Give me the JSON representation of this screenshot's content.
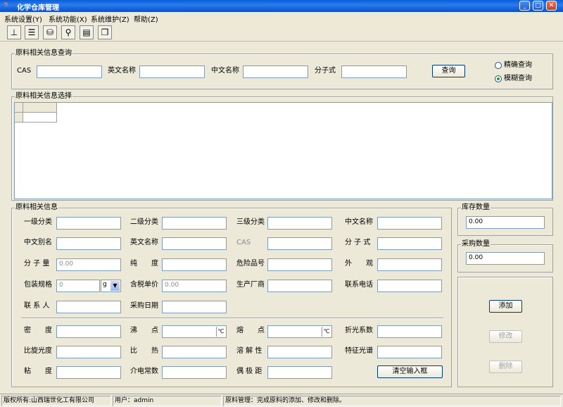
{
  "window": {
    "title": "化学仓库管理"
  },
  "menu": [
    "系统设置(Y)",
    "系统功能(X)",
    "系统维护(Z)",
    "帮助(Z)"
  ],
  "toolbar": {
    "icons": [
      "org-chart-icon",
      "document-list-icon",
      "database-icon",
      "binoculars-icon",
      "notepad-icon",
      "copy-icon"
    ],
    "glyphs": [
      "⊥",
      "☰",
      "⛁",
      "⚲",
      "▤",
      "❐"
    ]
  },
  "query": {
    "group_title": "原料相关信息查询",
    "cas_label": "CAS",
    "en_name_label": "英文名称",
    "cn_name_label": "中文名称",
    "formula_label": "分子式",
    "search_button": "查询",
    "exact_label": "精确查询",
    "fuzzy_label": "模糊查询"
  },
  "select": {
    "group_title": "原料相关信息选择"
  },
  "info": {
    "group_title": "原料相关信息",
    "level1": "一级分类",
    "level2": "二级分类",
    "level3": "三级分类",
    "cn_name": "中文名称",
    "cn_alias": "中文别名",
    "en_name": "英文名称",
    "cas": "CAS",
    "formula": "分 子 式",
    "mol_weight": "分 子 量",
    "mol_weight_value": "0.00",
    "purity": "纯　　度",
    "hazard_no": "危险品号",
    "appearance": "外　　观",
    "package": "包装规格",
    "package_value": "0",
    "package_unit": "g",
    "unit_price": "含税单价",
    "unit_price_value": "0.00",
    "manufacturer": "生产厂商",
    "phone": "联系电话",
    "contact": "联 系 人",
    "purchase_date": "采购日期",
    "density": "密　　度",
    "boiling": "沸　　点",
    "boiling_unit": "℃",
    "melting": "熔　　点",
    "melting_unit": "℃",
    "refraction": "折光系数",
    "rotation": "比旋光度",
    "specific_heat": "比　　热",
    "solubility": "溶 解 性",
    "spectrum": "特征光谱",
    "viscosity": "粘　　度",
    "dielectric": "介电常数",
    "dipole": "偶 极 距",
    "clear_button": "清空输入框"
  },
  "stock": {
    "title": "库存数量",
    "value": "0.00"
  },
  "purchase": {
    "title": "采购数量",
    "value": "0.00"
  },
  "actions": {
    "add": "添加",
    "modify": "修改",
    "delete": "删除"
  },
  "status": {
    "copyright": "版权所有:山西瑞世化工有限公司",
    "user": "用户：admin",
    "message": "原料管理：完成原料的添加、修改和删除。"
  }
}
